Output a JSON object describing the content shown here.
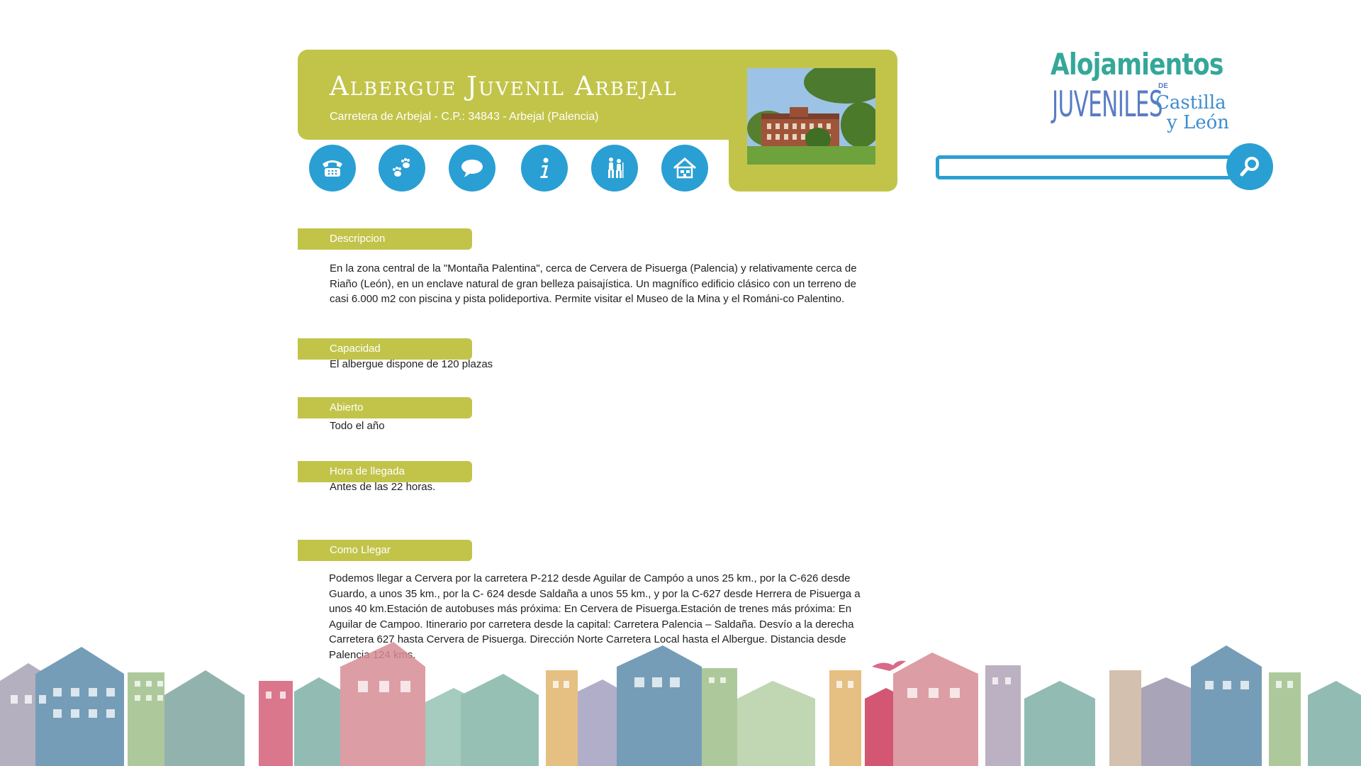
{
  "header": {
    "title": "Albergue Juvenil Arbejal",
    "address": "Carretera de Arbejal - C.P.: 34843 - Arbejal (Palencia)"
  },
  "icons": [
    {
      "name": "phone-icon",
      "label": "phone"
    },
    {
      "name": "pawprints-icon",
      "label": "footprints"
    },
    {
      "name": "chat-bubble-icon",
      "label": "comments"
    },
    {
      "name": "info-icon",
      "label": "info"
    },
    {
      "name": "hikers-icon",
      "label": "hikers"
    },
    {
      "name": "house-icon",
      "label": "house"
    }
  ],
  "logo": {
    "line1": "Alojamientos",
    "line2": "JUVENILES",
    "de": "DE",
    "line3": "Castilla",
    "line4": "y León"
  },
  "search": {
    "value": "",
    "placeholder": ""
  },
  "sections": {
    "descripcion": {
      "title": "Descripcion",
      "text": "En la zona central de la \"Montaña Palentina\", cerca de Cervera de Pisuerga (Palencia) y relativamente cerca de Riaño (León), en un enclave natural de gran belleza paisajística. Un magnífico edificio clásico con un terreno de casi 6.000 m2 con piscina y pista polideportiva. Permite visitar el Museo de la Mina y el Románi-co Palentino."
    },
    "capacidad": {
      "title": "Capacidad",
      "text": "El albergue dispone de 120 plazas"
    },
    "abierto": {
      "title": "Abierto",
      "text": "Todo el año"
    },
    "hora": {
      "title": "Hora de llegada",
      "text": "Antes de las 22 horas."
    },
    "como": {
      "title": "Como Llegar",
      "text": "Podemos llegar a Cervera por la carretera P-212 desde Aguilar de Campóo a unos 25 km., por la C-626 desde Guardo, a unos 35 km., por la C- 624 desde Saldaña a unos 55 km., y por la C-627 desde Herrera de Pisuerga a unos 40 km.Estación de autobuses más próxima: En Cervera de Pisuerga.Estación de trenes más próxima: En Aguilar de Campoo.                Itinerario por carretera desde la capital: Carretera Palencia – Saldaña. Desvío a la derecha Carretera 627 hasta Cervera de Pisuerga. Dirección Norte Carretera Local hasta el Albergue. Distancia desde Palencia 124 kms."
    }
  },
  "colors": {
    "accent_green": "#c2c44a",
    "accent_blue": "#2a9fd4",
    "logo_teal": "#35a79a",
    "logo_blue": "#5a7cc4"
  }
}
